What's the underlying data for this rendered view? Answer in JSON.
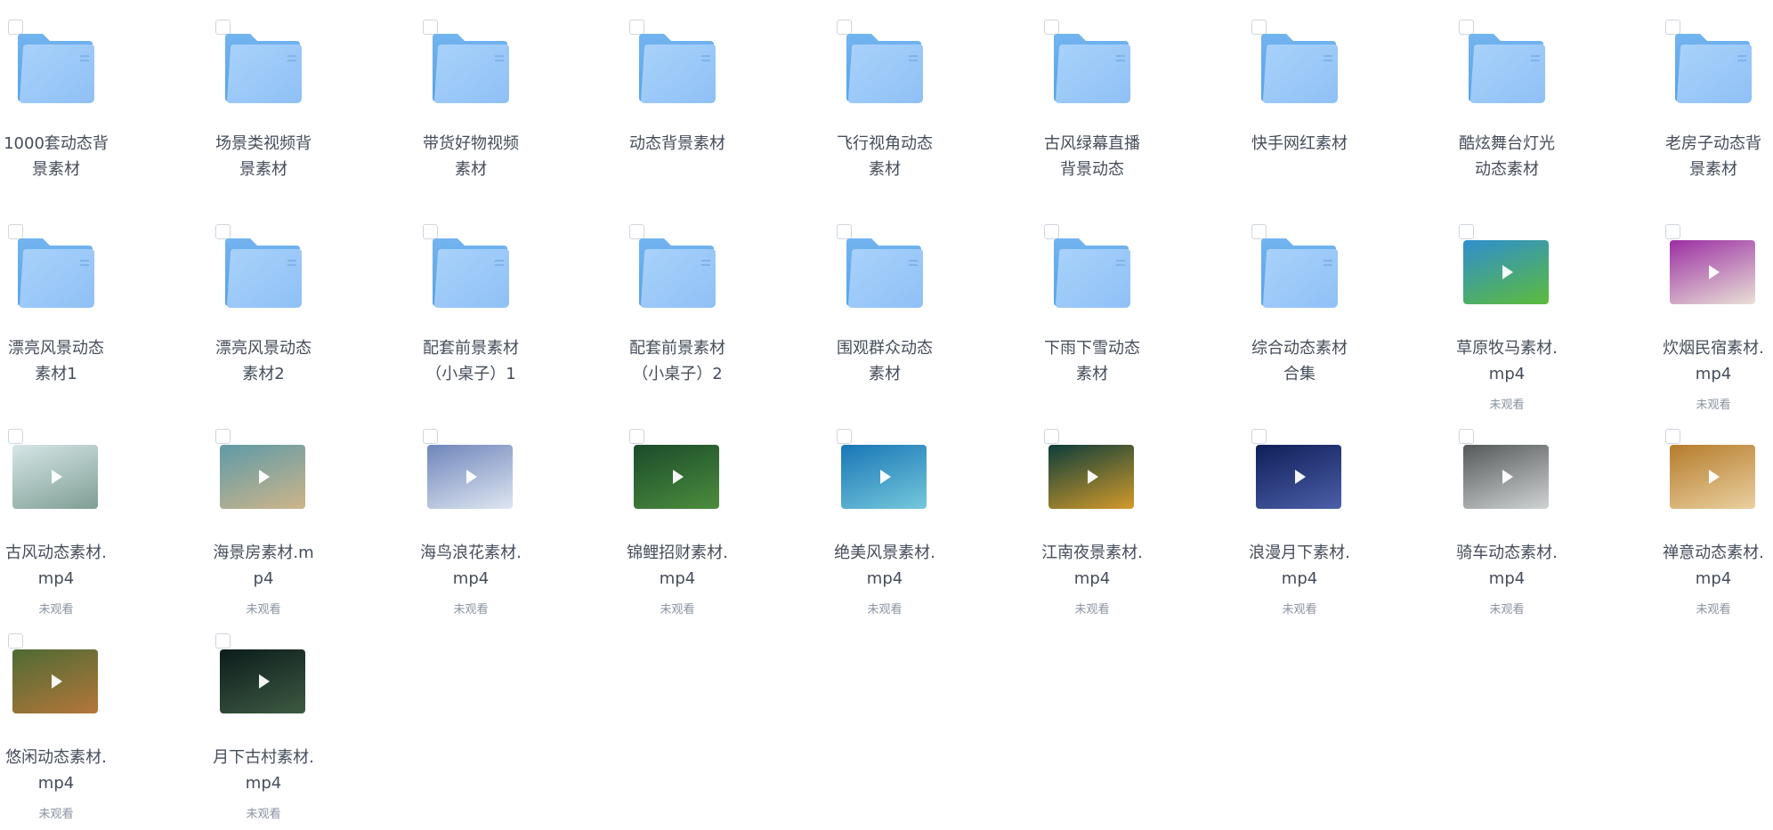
{
  "items": [
    {
      "type": "folder",
      "name": "1000套动态背景素材"
    },
    {
      "type": "folder",
      "name": "场景类视频背景素材"
    },
    {
      "type": "folder",
      "name": "带货好物视频素材"
    },
    {
      "type": "folder",
      "name": "动态背景素材"
    },
    {
      "type": "folder",
      "name": "飞行视角动态素材"
    },
    {
      "type": "folder",
      "name": "古风绿幕直播背景动态"
    },
    {
      "type": "folder",
      "name": "快手网红素材"
    },
    {
      "type": "folder",
      "name": "酷炫舞台灯光动态素材"
    },
    {
      "type": "folder",
      "name": "老房子动态背景素材"
    },
    {
      "type": "folder",
      "name": "漂亮风景动态素材1"
    },
    {
      "type": "folder",
      "name": "漂亮风景动态素材2"
    },
    {
      "type": "folder",
      "name": "配套前景素材（小桌子）1"
    },
    {
      "type": "folder",
      "name": "配套前景素材（小桌子）2"
    },
    {
      "type": "folder",
      "name": "围观群众动态素材"
    },
    {
      "type": "folder",
      "name": "下雨下雪动态素材"
    },
    {
      "type": "folder",
      "name": "综合动态素材合集"
    },
    {
      "type": "video",
      "name": "草原牧马素材.mp4",
      "status": "未观看",
      "thumb": [
        "#2f8fcf",
        "#5dbb3a"
      ]
    },
    {
      "type": "video",
      "name": "炊烟民宿素材.mp4",
      "status": "未观看",
      "thumb": [
        "#9b2fa3",
        "#e9e1d6"
      ]
    },
    {
      "type": "video",
      "name": "古风动态素材.mp4",
      "status": "未观看",
      "thumb": [
        "#d5e6e7",
        "#7f9e94"
      ]
    },
    {
      "type": "video",
      "name": "海景房素材.mp4",
      "status": "未观看",
      "thumb": [
        "#5f9aa7",
        "#cdb58a"
      ]
    },
    {
      "type": "video",
      "name": "海鸟浪花素材.mp4",
      "status": "未观看",
      "thumb": [
        "#6f86bb",
        "#dfe6f1"
      ]
    },
    {
      "type": "video",
      "name": "锦鲤招财素材.mp4",
      "status": "未观看",
      "thumb": [
        "#1b4b2b",
        "#4c8d3d"
      ]
    },
    {
      "type": "video",
      "name": "绝美风景素材.mp4",
      "status": "未观看",
      "thumb": [
        "#1976b6",
        "#74c8db"
      ]
    },
    {
      "type": "video",
      "name": "江南夜景素材.mp4",
      "status": "未观看",
      "thumb": [
        "#0d3d3a",
        "#d39a2a"
      ]
    },
    {
      "type": "video",
      "name": "浪漫月下素材.mp4",
      "status": "未观看",
      "thumb": [
        "#0e1f58",
        "#4c5fa8"
      ]
    },
    {
      "type": "video",
      "name": "骑车动态素材.mp4",
      "status": "未观看",
      "thumb": [
        "#56595a",
        "#cfd3d4"
      ]
    },
    {
      "type": "video",
      "name": "禅意动态素材.mp4",
      "status": "未观看",
      "thumb": [
        "#b57c2c",
        "#ead0a0"
      ]
    },
    {
      "type": "video",
      "name": "悠闲动态素材.mp4",
      "status": "未观看",
      "thumb": [
        "#4e6b34",
        "#b4763a"
      ]
    },
    {
      "type": "video",
      "name": "月下古村素材.mp4",
      "status": "未观看",
      "thumb": [
        "#0c1c1b",
        "#3d5a42"
      ]
    }
  ]
}
